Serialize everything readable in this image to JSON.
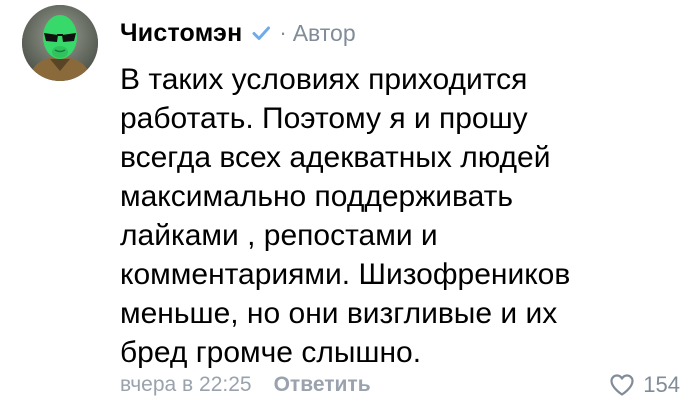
{
  "comment": {
    "author": {
      "name": "Чистомэн",
      "role": "Автор",
      "separator": "·",
      "verified_icon": "verified-check-icon",
      "avatar_icon": "alien-avatar"
    },
    "text_lines": [
      "В таких условиях приходится",
      "работать. Поэтому я и прошу",
      "всегда всех адекватных людей",
      "максимально поддерживать",
      "лайками , репостами и",
      "комментариями. Шизофреников",
      "меньше, но они визгливые и их",
      "бред громче слышно."
    ],
    "timestamp": "вчера в 22:25",
    "reply_label": "Ответить",
    "like_icon": "heart-outline-icon",
    "like_count": "154"
  },
  "colors": {
    "text": "#000000",
    "secondary": "#818c99",
    "verified": "#71aaeb",
    "avatar_face": "#37d96a"
  }
}
